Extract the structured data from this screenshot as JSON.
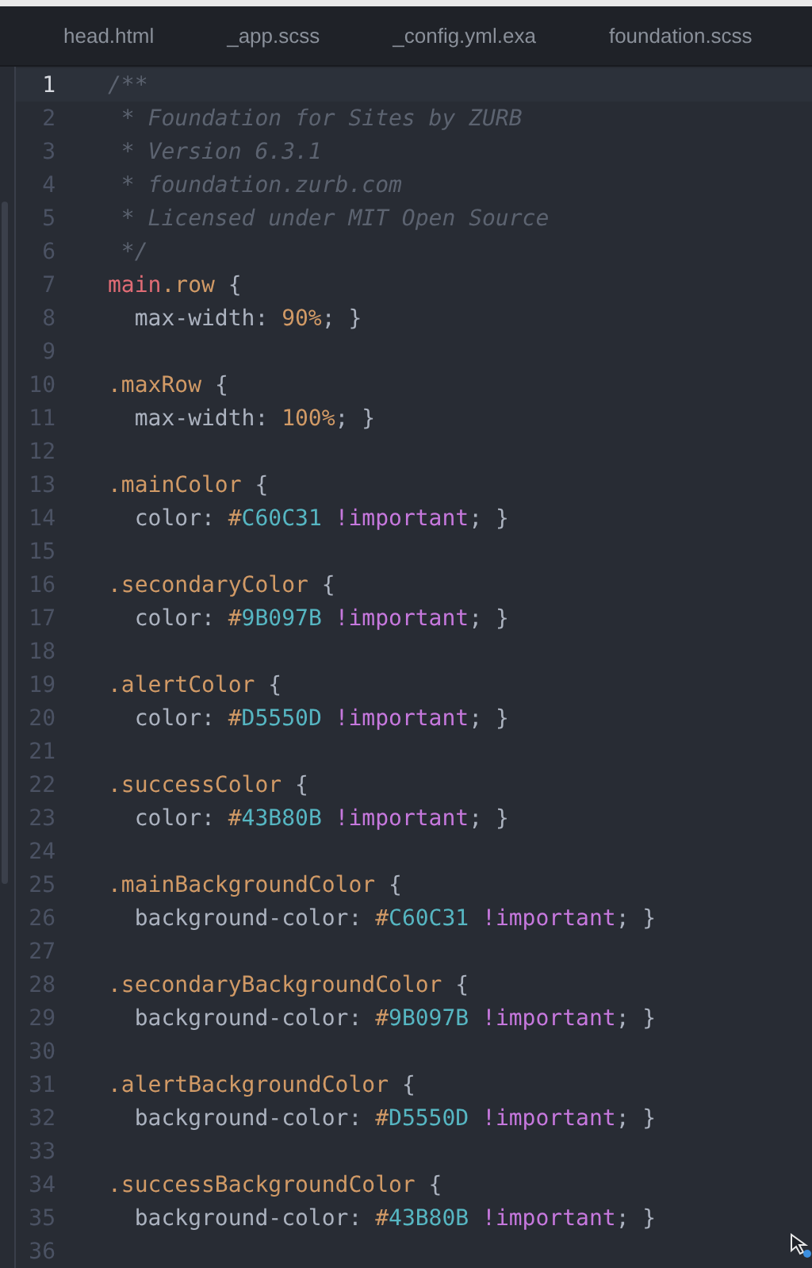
{
  "tabs": [
    {
      "label": "head.html"
    },
    {
      "label": "_app.scss"
    },
    {
      "label": "_config.yml.exa"
    },
    {
      "label": "foundation.scss"
    }
  ],
  "editor": {
    "lines": [
      {
        "number": "1",
        "current": true,
        "tokens": [
          {
            "kind": "comment",
            "text": "/**"
          }
        ]
      },
      {
        "number": "2",
        "current": false,
        "tokens": [
          {
            "kind": "comment",
            "text": " * Foundation for Sites by ZURB"
          }
        ]
      },
      {
        "number": "3",
        "current": false,
        "tokens": [
          {
            "kind": "comment",
            "text": " * Version 6.3.1"
          }
        ]
      },
      {
        "number": "4",
        "current": false,
        "tokens": [
          {
            "kind": "comment",
            "text": " * foundation.zurb.com"
          }
        ]
      },
      {
        "number": "5",
        "current": false,
        "tokens": [
          {
            "kind": "comment",
            "text": " * Licensed under MIT Open Source"
          }
        ]
      },
      {
        "number": "6",
        "current": false,
        "tokens": [
          {
            "kind": "comment",
            "text": " */"
          }
        ]
      },
      {
        "number": "7",
        "current": false,
        "tokens": [
          {
            "kind": "tag",
            "text": "main"
          },
          {
            "kind": "selector",
            "text": ".row"
          },
          {
            "kind": "plain",
            "text": " {"
          }
        ]
      },
      {
        "number": "8",
        "current": false,
        "tokens": [
          {
            "kind": "plain",
            "text": "  max-width: "
          },
          {
            "kind": "number",
            "text": "90%"
          },
          {
            "kind": "plain",
            "text": "; }"
          }
        ]
      },
      {
        "number": "9",
        "current": false
      },
      {
        "number": "10",
        "current": false,
        "tokens": [
          {
            "kind": "selector",
            "text": ".maxRow"
          },
          {
            "kind": "plain",
            "text": " {"
          }
        ]
      },
      {
        "number": "11",
        "current": false,
        "tokens": [
          {
            "kind": "plain",
            "text": "  max-width: "
          },
          {
            "kind": "number",
            "text": "100%"
          },
          {
            "kind": "plain",
            "text": "; }"
          }
        ]
      },
      {
        "number": "12",
        "current": false
      },
      {
        "number": "13",
        "current": false,
        "tokens": [
          {
            "kind": "selector",
            "text": ".mainColor"
          },
          {
            "kind": "plain",
            "text": " {"
          }
        ]
      },
      {
        "number": "14",
        "current": false,
        "tokens": [
          {
            "kind": "plain",
            "text": "  color: "
          },
          {
            "kind": "hash",
            "text": "#"
          },
          {
            "kind": "hex",
            "text": "C60C31"
          },
          {
            "kind": "important",
            "text": " !important"
          },
          {
            "kind": "plain",
            "text": "; }"
          }
        ]
      },
      {
        "number": "15",
        "current": false
      },
      {
        "number": "16",
        "current": false,
        "tokens": [
          {
            "kind": "selector",
            "text": ".secondaryColor"
          },
          {
            "kind": "plain",
            "text": " {"
          }
        ]
      },
      {
        "number": "17",
        "current": false,
        "tokens": [
          {
            "kind": "plain",
            "text": "  color: "
          },
          {
            "kind": "hash",
            "text": "#"
          },
          {
            "kind": "hex",
            "text": "9B097B"
          },
          {
            "kind": "important",
            "text": " !important"
          },
          {
            "kind": "plain",
            "text": "; }"
          }
        ]
      },
      {
        "number": "18",
        "current": false
      },
      {
        "number": "19",
        "current": false,
        "tokens": [
          {
            "kind": "selector",
            "text": ".alertColor"
          },
          {
            "kind": "plain",
            "text": " {"
          }
        ]
      },
      {
        "number": "20",
        "current": false,
        "tokens": [
          {
            "kind": "plain",
            "text": "  color: "
          },
          {
            "kind": "hash",
            "text": "#"
          },
          {
            "kind": "hex",
            "text": "D5550D"
          },
          {
            "kind": "important",
            "text": " !important"
          },
          {
            "kind": "plain",
            "text": "; }"
          }
        ]
      },
      {
        "number": "21",
        "current": false
      },
      {
        "number": "22",
        "current": false,
        "tokens": [
          {
            "kind": "selector",
            "text": ".successColor"
          },
          {
            "kind": "plain",
            "text": " {"
          }
        ]
      },
      {
        "number": "23",
        "current": false,
        "tokens": [
          {
            "kind": "plain",
            "text": "  color: "
          },
          {
            "kind": "hash",
            "text": "#"
          },
          {
            "kind": "hex",
            "text": "43B80B"
          },
          {
            "kind": "important",
            "text": " !important"
          },
          {
            "kind": "plain",
            "text": "; }"
          }
        ]
      },
      {
        "number": "24",
        "current": false
      },
      {
        "number": "25",
        "current": false,
        "tokens": [
          {
            "kind": "selector",
            "text": ".mainBackgroundColor"
          },
          {
            "kind": "plain",
            "text": " {"
          }
        ]
      },
      {
        "number": "26",
        "current": false,
        "tokens": [
          {
            "kind": "plain",
            "text": "  background-color: "
          },
          {
            "kind": "hash",
            "text": "#"
          },
          {
            "kind": "hex",
            "text": "C60C31"
          },
          {
            "kind": "important",
            "text": " !important"
          },
          {
            "kind": "plain",
            "text": "; }"
          }
        ]
      },
      {
        "number": "27",
        "current": false
      },
      {
        "number": "28",
        "current": false,
        "tokens": [
          {
            "kind": "selector",
            "text": ".secondaryBackgroundColor"
          },
          {
            "kind": "plain",
            "text": " {"
          }
        ]
      },
      {
        "number": "29",
        "current": false,
        "tokens": [
          {
            "kind": "plain",
            "text": "  background-color: "
          },
          {
            "kind": "hash",
            "text": "#"
          },
          {
            "kind": "hex",
            "text": "9B097B"
          },
          {
            "kind": "important",
            "text": " !important"
          },
          {
            "kind": "plain",
            "text": "; }"
          }
        ]
      },
      {
        "number": "30",
        "current": false
      },
      {
        "number": "31",
        "current": false,
        "tokens": [
          {
            "kind": "selector",
            "text": ".alertBackgroundColor"
          },
          {
            "kind": "plain",
            "text": " {"
          }
        ]
      },
      {
        "number": "32",
        "current": false,
        "tokens": [
          {
            "kind": "plain",
            "text": "  background-color: "
          },
          {
            "kind": "hash",
            "text": "#"
          },
          {
            "kind": "hex",
            "text": "D5550D"
          },
          {
            "kind": "important",
            "text": " !important"
          },
          {
            "kind": "plain",
            "text": "; }"
          }
        ]
      },
      {
        "number": "33",
        "current": false
      },
      {
        "number": "34",
        "current": false,
        "tokens": [
          {
            "kind": "selector",
            "text": ".successBackgroundColor"
          },
          {
            "kind": "plain",
            "text": " {"
          }
        ]
      },
      {
        "number": "35",
        "current": false,
        "tokens": [
          {
            "kind": "plain",
            "text": "  background-color: "
          },
          {
            "kind": "hash",
            "text": "#"
          },
          {
            "kind": "hex",
            "text": "43B80B"
          },
          {
            "kind": "important",
            "text": " !important"
          },
          {
            "kind": "plain",
            "text": "; }"
          }
        ]
      },
      {
        "number": "36",
        "current": false
      }
    ]
  }
}
